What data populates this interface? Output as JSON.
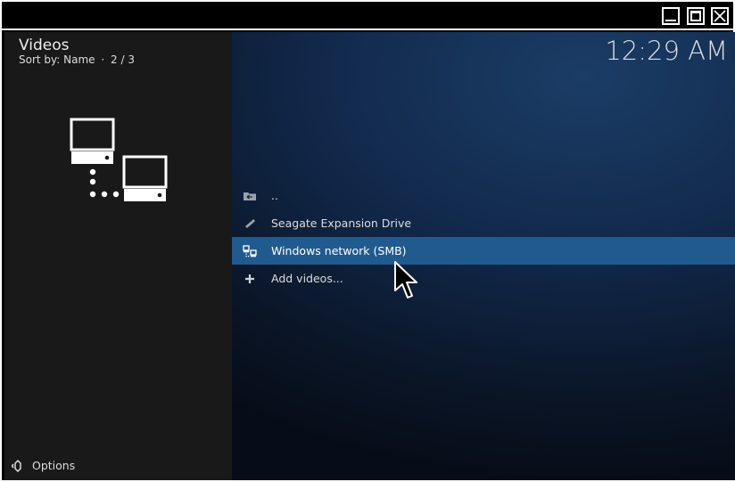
{
  "window": {
    "minimize_icon": "minimize-icon",
    "maximize_icon": "maximize-icon",
    "close_icon": "close-icon"
  },
  "header": {
    "title": "Videos",
    "sort_label": "Sort by: Name",
    "separator": "·",
    "page": "2 / 3",
    "clock": "12:29 AM"
  },
  "preview": {
    "icon": "network-computers-icon"
  },
  "list": {
    "items": [
      {
        "label": "..",
        "icon": "folder-back-icon",
        "selected": false
      },
      {
        "label": "Seagate Expansion Drive",
        "icon": "usb-drive-icon",
        "selected": false
      },
      {
        "label": "Windows network (SMB)",
        "icon": "network-icon",
        "selected": true
      },
      {
        "label": "Add videos...",
        "icon": "plus-icon",
        "selected": false
      }
    ]
  },
  "footer": {
    "options_label": "Options",
    "options_icon": "options-icon"
  },
  "colors": {
    "selection": "#215a8e",
    "left_panel": "#191919",
    "background_dark": "#0a1526"
  }
}
